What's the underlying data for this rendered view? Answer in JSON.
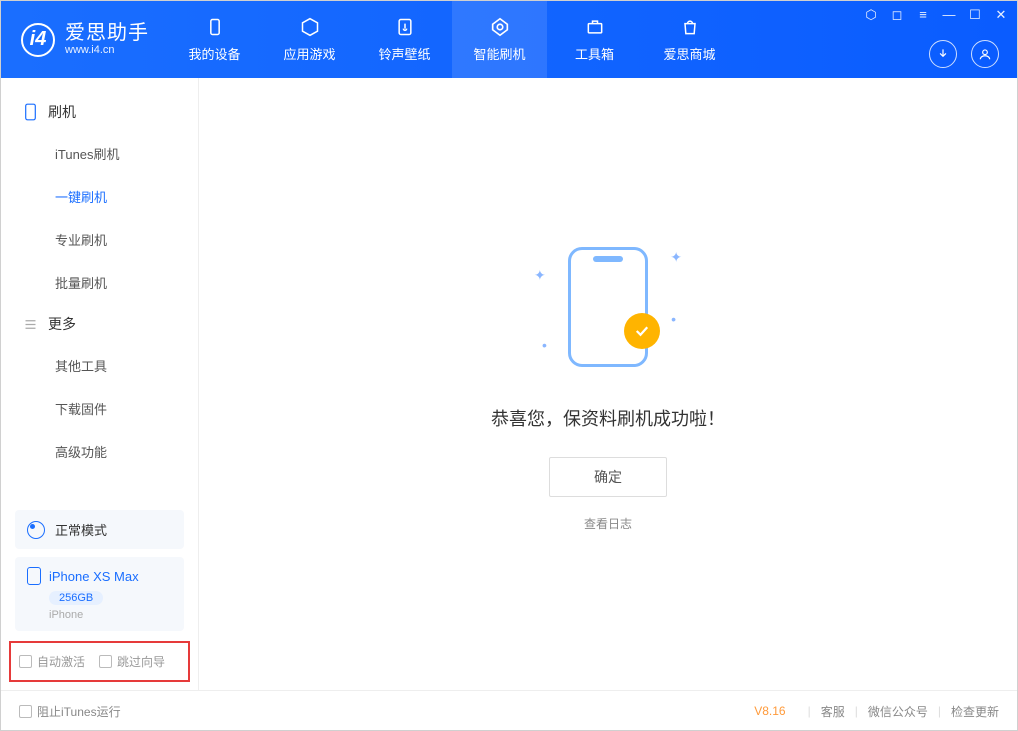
{
  "brand": {
    "name": "爱思助手",
    "url": "www.i4.cn"
  },
  "nav": [
    {
      "label": "我的设备"
    },
    {
      "label": "应用游戏"
    },
    {
      "label": "铃声壁纸"
    },
    {
      "label": "智能刷机"
    },
    {
      "label": "工具箱"
    },
    {
      "label": "爱思商城"
    }
  ],
  "sidebar": {
    "section1_title": "刷机",
    "items1": [
      {
        "label": "iTunes刷机"
      },
      {
        "label": "一键刷机"
      },
      {
        "label": "专业刷机"
      },
      {
        "label": "批量刷机"
      }
    ],
    "section2_title": "更多",
    "items2": [
      {
        "label": "其他工具"
      },
      {
        "label": "下载固件"
      },
      {
        "label": "高级功能"
      }
    ],
    "mode_label": "正常模式",
    "device": {
      "name": "iPhone XS Max",
      "storage": "256GB",
      "type": "iPhone"
    },
    "check_auto_activate": "自动激活",
    "check_skip_guide": "跳过向导"
  },
  "main": {
    "success_text": "恭喜您，保资料刷机成功啦！",
    "ok_button": "确定",
    "view_log": "查看日志"
  },
  "footer": {
    "block_itunes": "阻止iTunes运行",
    "version": "V8.16",
    "support": "客服",
    "wechat": "微信公众号",
    "check_update": "检查更新"
  }
}
